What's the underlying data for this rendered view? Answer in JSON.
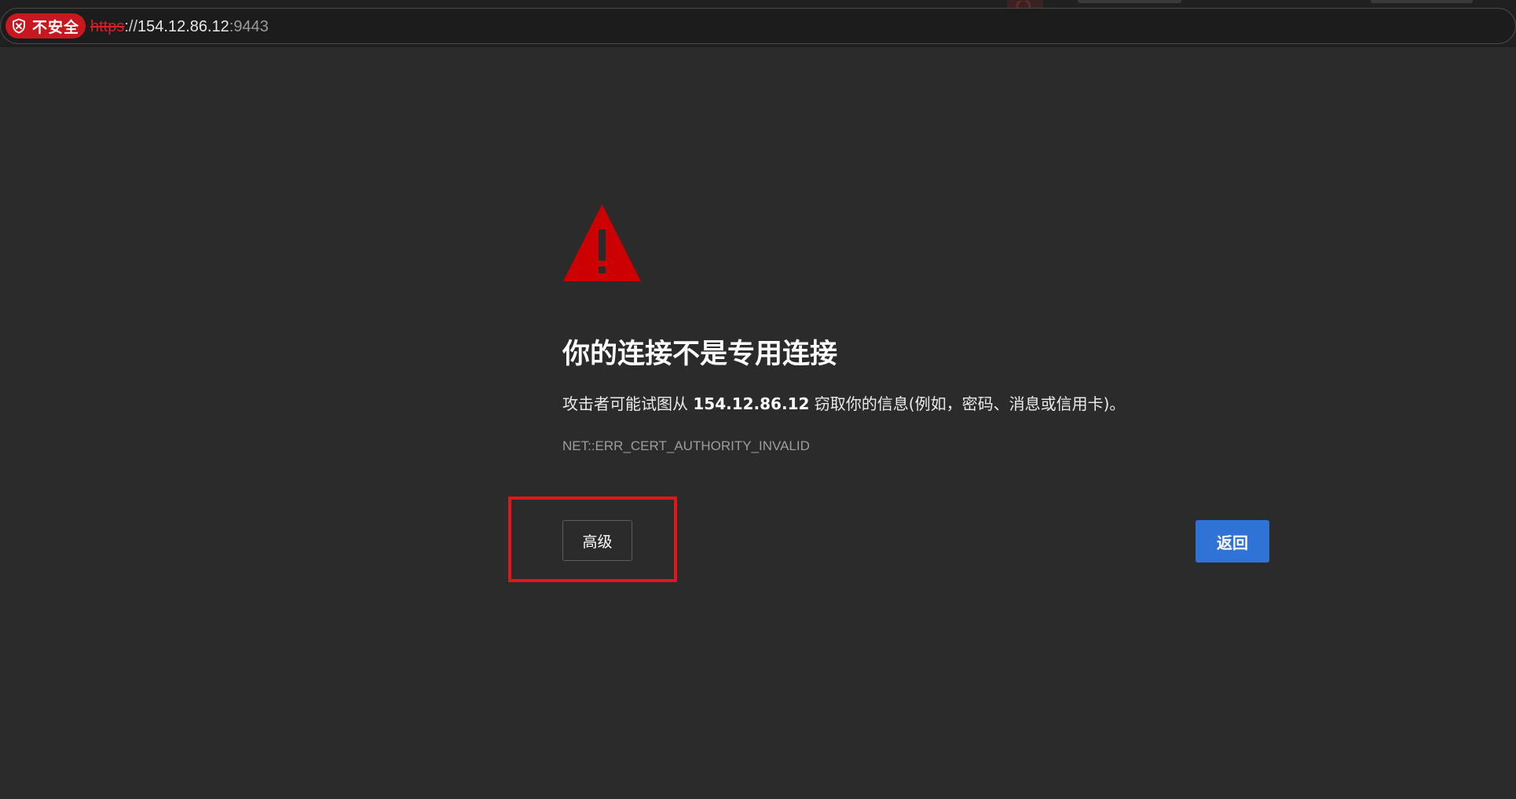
{
  "browser": {
    "security_chip": {
      "label": "不安全",
      "icon": "shield-warning-icon",
      "color": "#c8171e"
    },
    "address": {
      "scheme": "https",
      "separator": "://",
      "host": "154.12.86.12",
      "port": ":9443"
    },
    "toolbar_icon": "search-icon"
  },
  "interstitial": {
    "icon": "warning-triangle-icon",
    "icon_color": "#cc0000",
    "heading": "你的连接不是专用连接",
    "body": {
      "prefix": "攻击者可能试图从 ",
      "host": "154.12.86.12",
      "suffix": " 窃取你的信息(例如，密码、消息或信用卡)。"
    },
    "error_code": "NET::ERR_CERT_AUTHORITY_INVALID",
    "buttons": {
      "advanced": "高级",
      "back": "返回"
    },
    "back_button_color": "#2f73d6",
    "highlight_color": "#e0161b"
  }
}
